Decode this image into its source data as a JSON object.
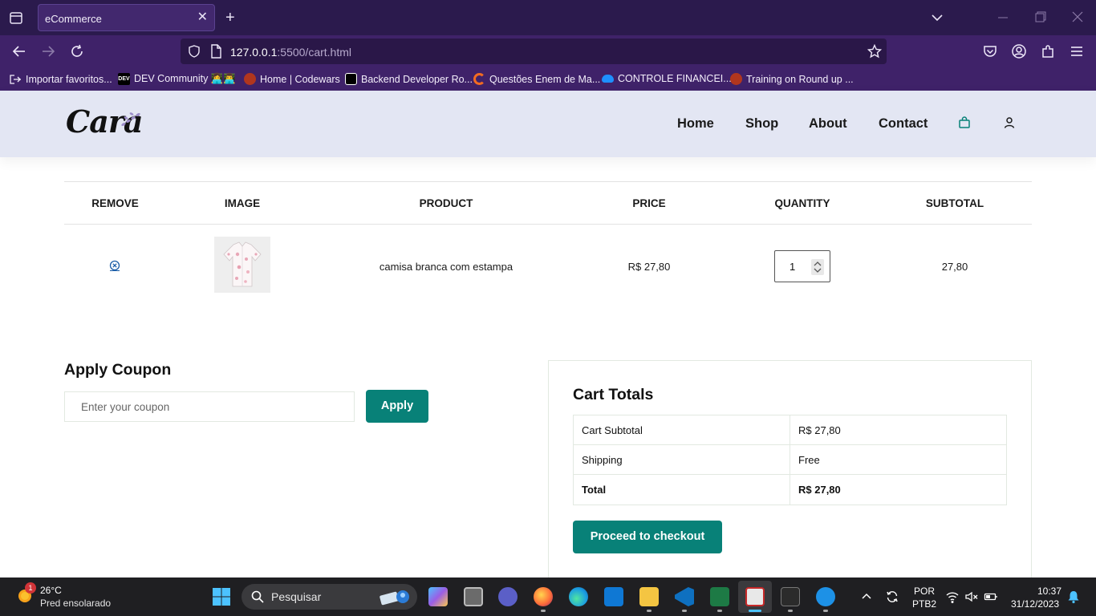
{
  "browser": {
    "tab_title": "eCommerce",
    "url_host": "127.0.0.1",
    "url_path": ":5500/cart.html",
    "bookmarks": [
      "Importar favoritos...",
      "DEV Community 👩‍💻👨‍💻",
      "Home | Codewars",
      "Backend Developer Ro...",
      "Questões Enem de Ma...",
      "CONTROLE FINANCEI...",
      "Training on Round up ..."
    ]
  },
  "site": {
    "logo": "Cara",
    "menu": [
      "Home",
      "Shop",
      "About",
      "Contact"
    ],
    "accent_color": "#088178"
  },
  "cart": {
    "headers": [
      "REMOVE",
      "IMAGE",
      "PRODUCT",
      "PRICE",
      "QUANTITY",
      "SUBTOTAL"
    ],
    "items": [
      {
        "product": "camisa branca com estampa",
        "price": "R$ 27,80",
        "quantity": "1",
        "subtotal": "27,80"
      }
    ]
  },
  "coupon": {
    "title": "Apply Coupon",
    "placeholder": "Enter your coupon",
    "button": "Apply"
  },
  "totals": {
    "title": "Cart Totals",
    "rows": [
      {
        "label": "Cart Subtotal",
        "value": "R$ 27,80"
      },
      {
        "label": "Shipping",
        "value": "Free"
      },
      {
        "label": "Total",
        "value": "R$ 27,80"
      }
    ],
    "checkout_button": "Proceed to checkout"
  },
  "taskbar": {
    "weather_badge": "1",
    "temperature": "26°C",
    "weather": "Pred ensolarado",
    "search_label": "Pesquisar",
    "lang_1": "POR",
    "lang_2": "PTB2",
    "time": "10:37",
    "date": "31/12/2023"
  }
}
